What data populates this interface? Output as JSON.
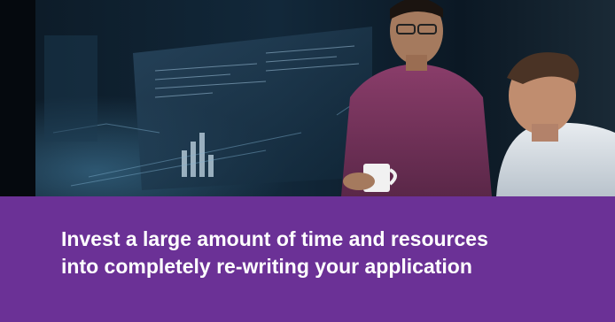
{
  "hero": {
    "image": "two-men-at-computer-screens-photo"
  },
  "caption": {
    "line1": "Invest a large amount of time and resources",
    "line2": "into completely re-writing your application"
  },
  "colors": {
    "panel": "#6b3196",
    "text": "#ffffff",
    "hero_dark": "#0a1420"
  }
}
